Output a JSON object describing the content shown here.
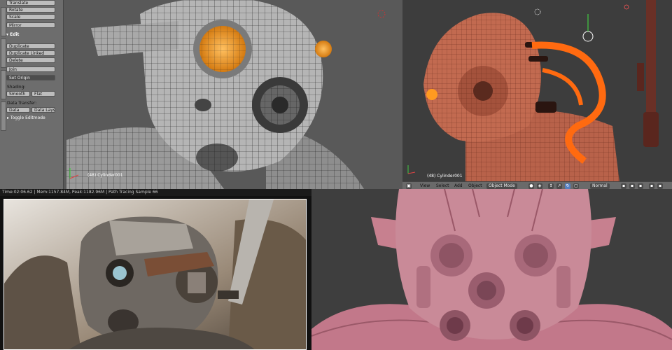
{
  "toolshelf": {
    "top_buttons": [
      "Translate",
      "Rotate",
      "Scale",
      "Mirror"
    ],
    "edit_header": "▾ Edit",
    "edit_buttons": [
      "Duplicate",
      "Duplicate Linked",
      "Delete",
      "Join",
      "Set Origin"
    ],
    "shading_label": "Shading:",
    "shading_buttons": [
      "Smooth",
      "Flat"
    ],
    "data_transfer_label": "Data Transfer:",
    "data_transfer_buttons": [
      "Data",
      "Data Lays"
    ],
    "toggle_editmode": "▸ Toggle Editmode"
  },
  "viewport_tl": {
    "object_label": "(48) Cylinder001"
  },
  "viewport_tr": {
    "object_label": "(48) Cylinder001"
  },
  "header": {
    "view": "View",
    "select": "Select",
    "add": "Add",
    "object": "Object",
    "mode": "Object Mode",
    "pivot": "Normal"
  },
  "render_status": "Time:02:06.62 | Mem:1157.84M, Peak:1182.96M | Path Tracing Sample 66",
  "colors": {
    "accent": "#ff7a1a",
    "skin": "#c2788a",
    "clay": "#b8624a"
  }
}
